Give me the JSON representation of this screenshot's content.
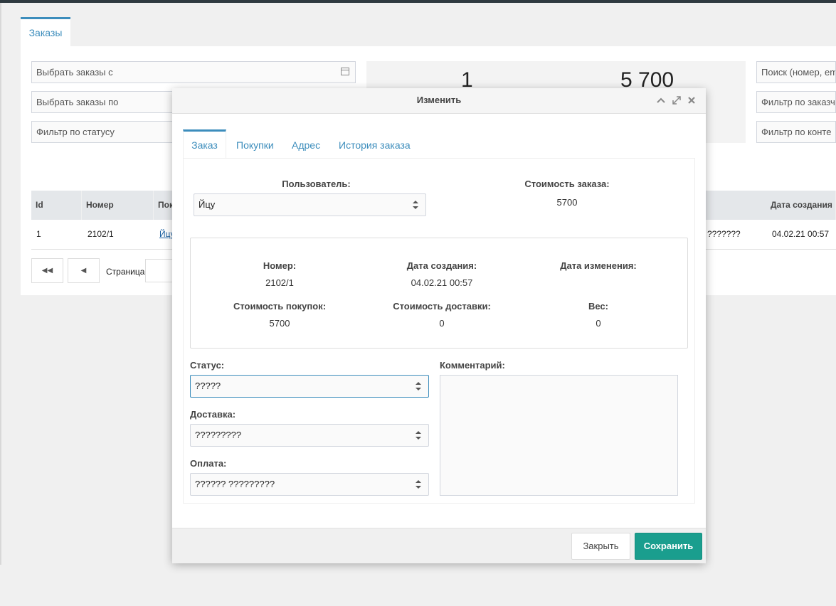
{
  "page": {
    "tab_label": "Заказы",
    "filters": {
      "date_from_placeholder": "Выбрать заказы с",
      "date_to_placeholder": "Выбрать заказы по",
      "status_placeholder": "Фильтр по статусу",
      "search_placeholder": "Поиск (номер, em",
      "customer_filter_placeholder": "Фильтр по заказчи",
      "contact_filter_placeholder": "Фильтр по конте"
    },
    "stats": {
      "count": "1",
      "total": "5 700"
    },
    "table": {
      "columns": [
        "Id",
        "Номер",
        "Пок",
        "Дата создания"
      ],
      "rows": [
        {
          "id": "1",
          "number": "2102/1",
          "customer": "Йцу",
          "status_partial": "???????",
          "created": "04.02.21 00:57"
        }
      ]
    },
    "pager": {
      "first_icon": "double-chevron-left-icon",
      "prev_icon": "chevron-left-icon",
      "page_label": "Страница"
    }
  },
  "modal": {
    "title": "Изменить",
    "header_icons": [
      "chevron-up-icon",
      "expand-icon",
      "close-icon"
    ],
    "tabs": [
      "Заказ",
      "Покупки",
      "Адрес",
      "История заказа"
    ],
    "active_tab": "Заказ",
    "user_label": "Пользователь:",
    "user_value": "Йцу",
    "order_cost_label": "Стоимость заказа:",
    "order_cost_value": "5700",
    "info": {
      "number_label": "Номер:",
      "number_value": "2102/1",
      "created_label": "Дата создания:",
      "created_value": "04.02.21 00:57",
      "modified_label": "Дата изменения:",
      "modified_value": "",
      "purchases_cost_label": "Стоимость покупок:",
      "purchases_cost_value": "5700",
      "delivery_cost_label": "Стоимость доставки:",
      "delivery_cost_value": "0",
      "weight_label": "Вес:",
      "weight_value": "0"
    },
    "status_label": "Статус:",
    "status_value": "?????",
    "delivery_label": "Доставка:",
    "delivery_value": "?????????",
    "payment_label": "Оплата:",
    "payment_value": "?????? ?????????",
    "comment_label": "Комментарий:",
    "comment_value": "",
    "close_button": "Закрыть",
    "save_button": "Сохранить"
  },
  "colors": {
    "accent": "#3c8dbc",
    "save": "#1a9e8e"
  }
}
